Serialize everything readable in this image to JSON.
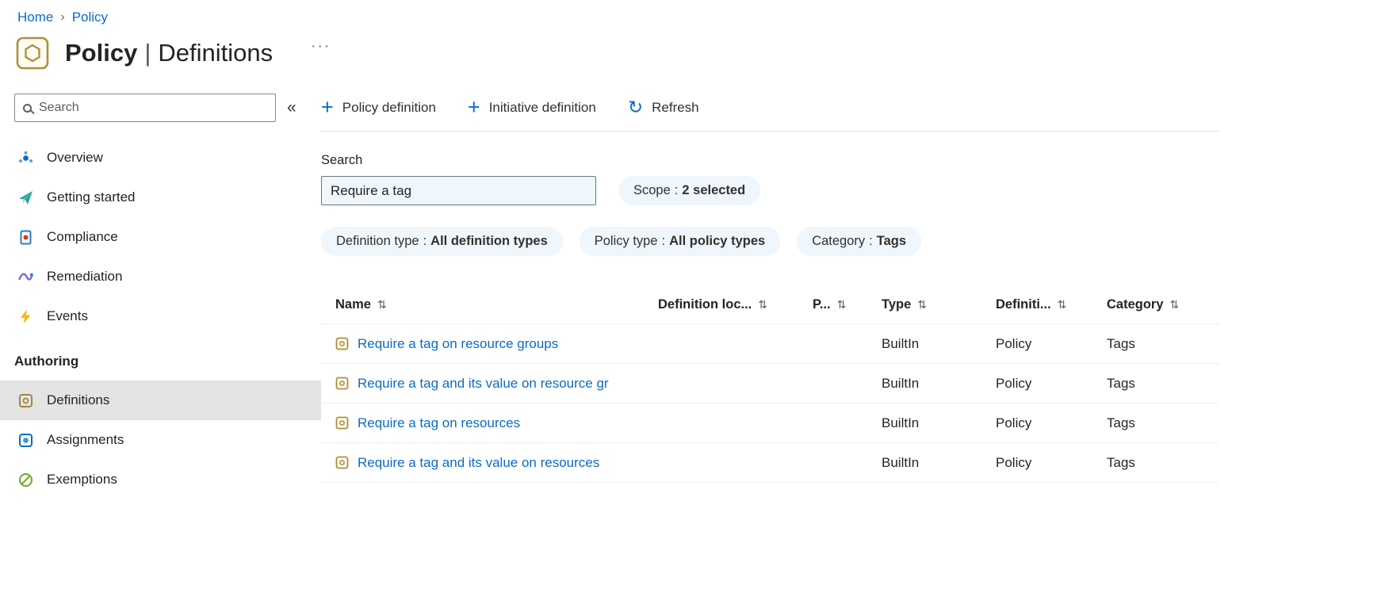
{
  "breadcrumb": {
    "items": [
      {
        "label": "Home"
      },
      {
        "label": "Policy"
      }
    ]
  },
  "header": {
    "title_primary": "Policy",
    "title_separator": "|",
    "title_secondary": "Definitions"
  },
  "icons": {
    "chevron": "›",
    "more": "···",
    "collapse": "«",
    "plus": "+",
    "refresh": "↻",
    "sort": "⇅"
  },
  "sidebar": {
    "search_placeholder": "Search",
    "items": [
      {
        "label": "Overview"
      },
      {
        "label": "Getting started"
      },
      {
        "label": "Compliance"
      },
      {
        "label": "Remediation"
      },
      {
        "label": "Events"
      }
    ],
    "section_title": "Authoring",
    "authoring_items": [
      {
        "label": "Definitions",
        "selected": true
      },
      {
        "label": "Assignments",
        "selected": false
      },
      {
        "label": "Exemptions",
        "selected": false
      }
    ]
  },
  "toolbar": {
    "buttons": [
      {
        "label": "Policy definition"
      },
      {
        "label": "Initiative definition"
      },
      {
        "label": "Refresh"
      }
    ]
  },
  "filters": {
    "search_label": "Search",
    "search_value": "Require a tag",
    "pill_separator": ":",
    "pills": [
      {
        "name": "Scope",
        "value": "2 selected"
      },
      {
        "name": "Definition type",
        "value": "All definition types"
      },
      {
        "name": "Policy type",
        "value": "All policy types"
      },
      {
        "name": "Category",
        "value": "Tags"
      }
    ]
  },
  "table": {
    "columns": [
      "Name",
      "Definition loc...",
      "P...",
      "Type",
      "Definiti...",
      "Category"
    ],
    "rows": [
      {
        "name": "Require a tag on resource groups",
        "definition_location": "",
        "policies": "",
        "type": "BuiltIn",
        "definition_type": "Policy",
        "category": "Tags"
      },
      {
        "name": "Require a tag and its value on resource gr",
        "definition_location": "",
        "policies": "",
        "type": "BuiltIn",
        "definition_type": "Policy",
        "category": "Tags"
      },
      {
        "name": "Require a tag on resources",
        "definition_location": "",
        "policies": "",
        "type": "BuiltIn",
        "definition_type": "Policy",
        "category": "Tags"
      },
      {
        "name": "Require a tag and its value on resources",
        "definition_location": "",
        "policies": "",
        "type": "BuiltIn",
        "definition_type": "Policy",
        "category": "Tags"
      }
    ]
  },
  "colors": {
    "accent": "#0b6cc4",
    "pill_background": "#eff6fc",
    "selected_item_background": "#e4e4e4",
    "policy_icon_tan": "#b08d3e",
    "events_yellow": "#ffb900",
    "exemptions_green": "#73aa24",
    "remediation_purple": "#8661c5",
    "compliance_orange": "#d83b01"
  }
}
